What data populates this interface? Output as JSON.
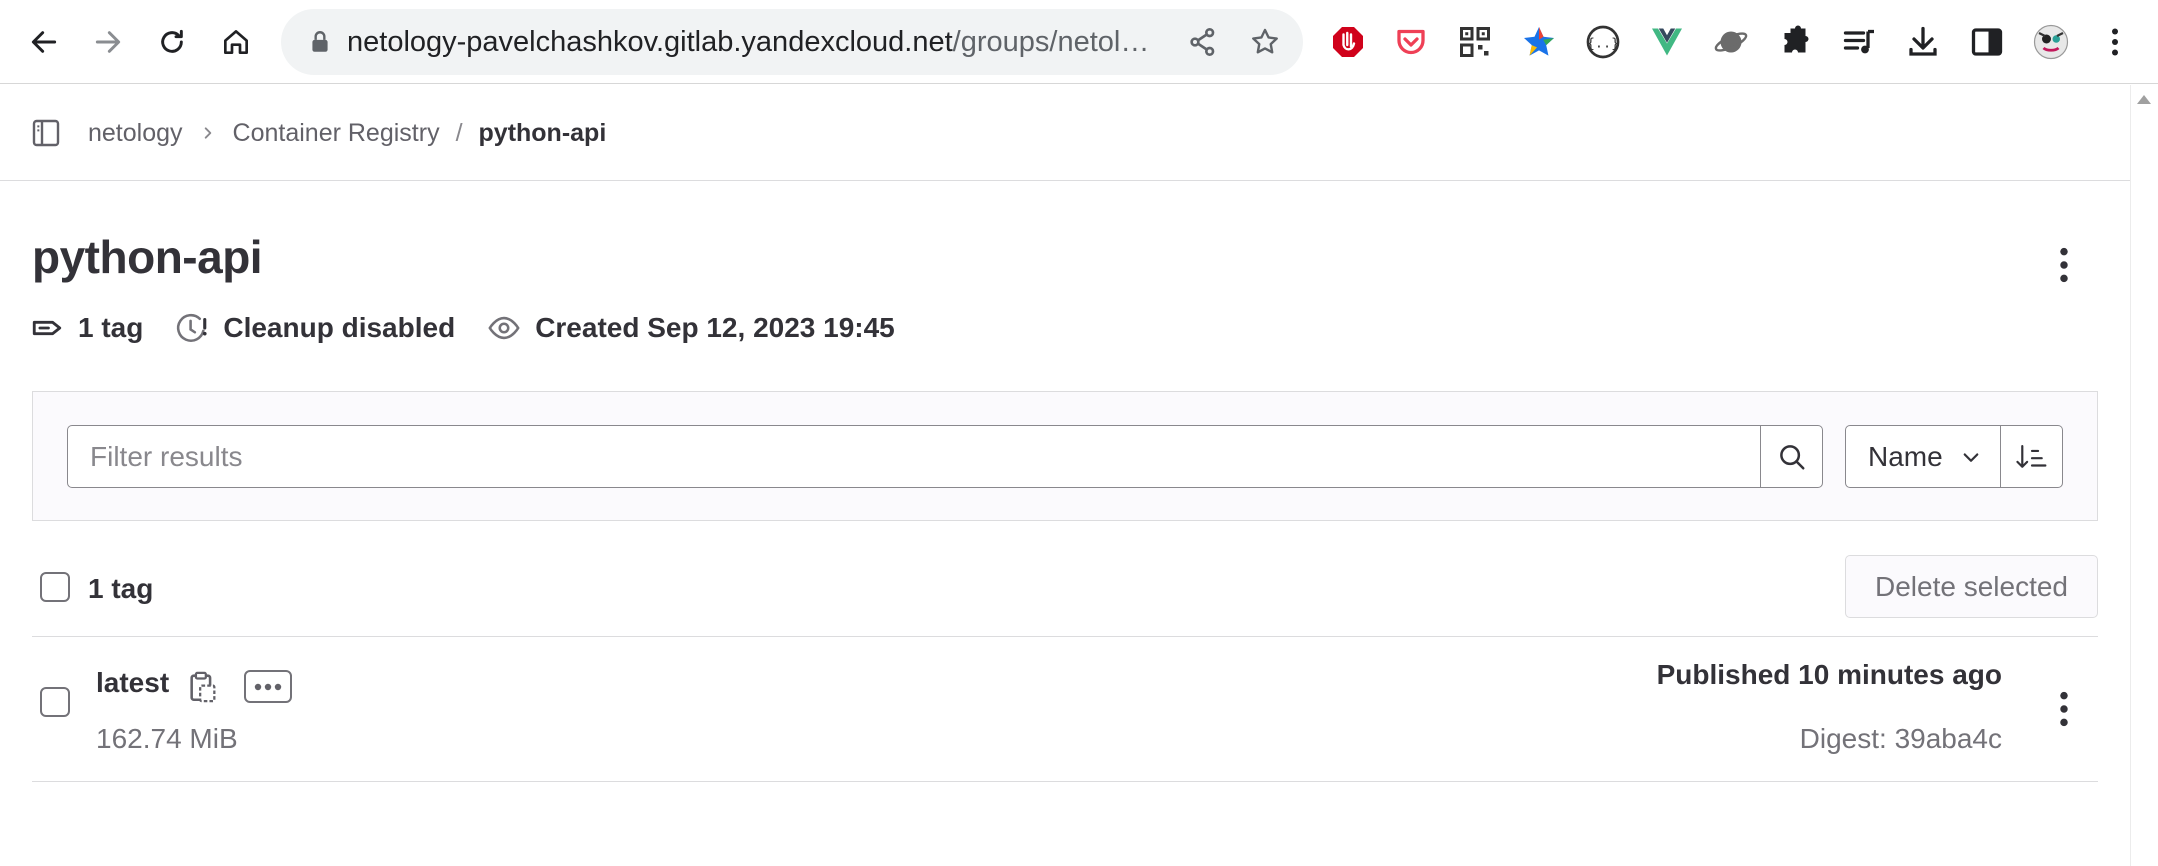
{
  "browser": {
    "url_host": "netology-pavelchashkov.gitlab.yandexcloud.net",
    "url_path": "/groups/netol…",
    "extensions": [
      "ublock-icon",
      "pocket-icon",
      "qr-code-icon",
      "colorful-star-icon",
      "json-viewer-icon",
      "vue-devtools-icon",
      "planet-icon",
      "extensions-puzzle-icon",
      "media-control-icon",
      "download-icon",
      "side-panel-icon",
      "profile-avatar",
      "chrome-menu-icon"
    ]
  },
  "breadcrumb": {
    "items": [
      "netology",
      "Container Registry"
    ],
    "separator": "/",
    "current": "python-api"
  },
  "header": {
    "title": "python-api"
  },
  "meta": {
    "tags": "1 tag",
    "cleanup": "Cleanup disabled",
    "created": "Created Sep 12, 2023 19:45"
  },
  "filter": {
    "placeholder": "Filter results",
    "sort_label": "Name"
  },
  "bulk": {
    "count_label": "1 tag",
    "delete_label": "Delete selected"
  },
  "tags": [
    {
      "name": "latest",
      "size": "162.74 MiB",
      "published": "Published 10 minutes ago",
      "digest": "Digest: 39aba4c"
    }
  ],
  "colors": {
    "text_primary": "#333238",
    "text_secondary": "#737278",
    "border": "#dcdcde",
    "panel_bg": "#fbfafd"
  }
}
